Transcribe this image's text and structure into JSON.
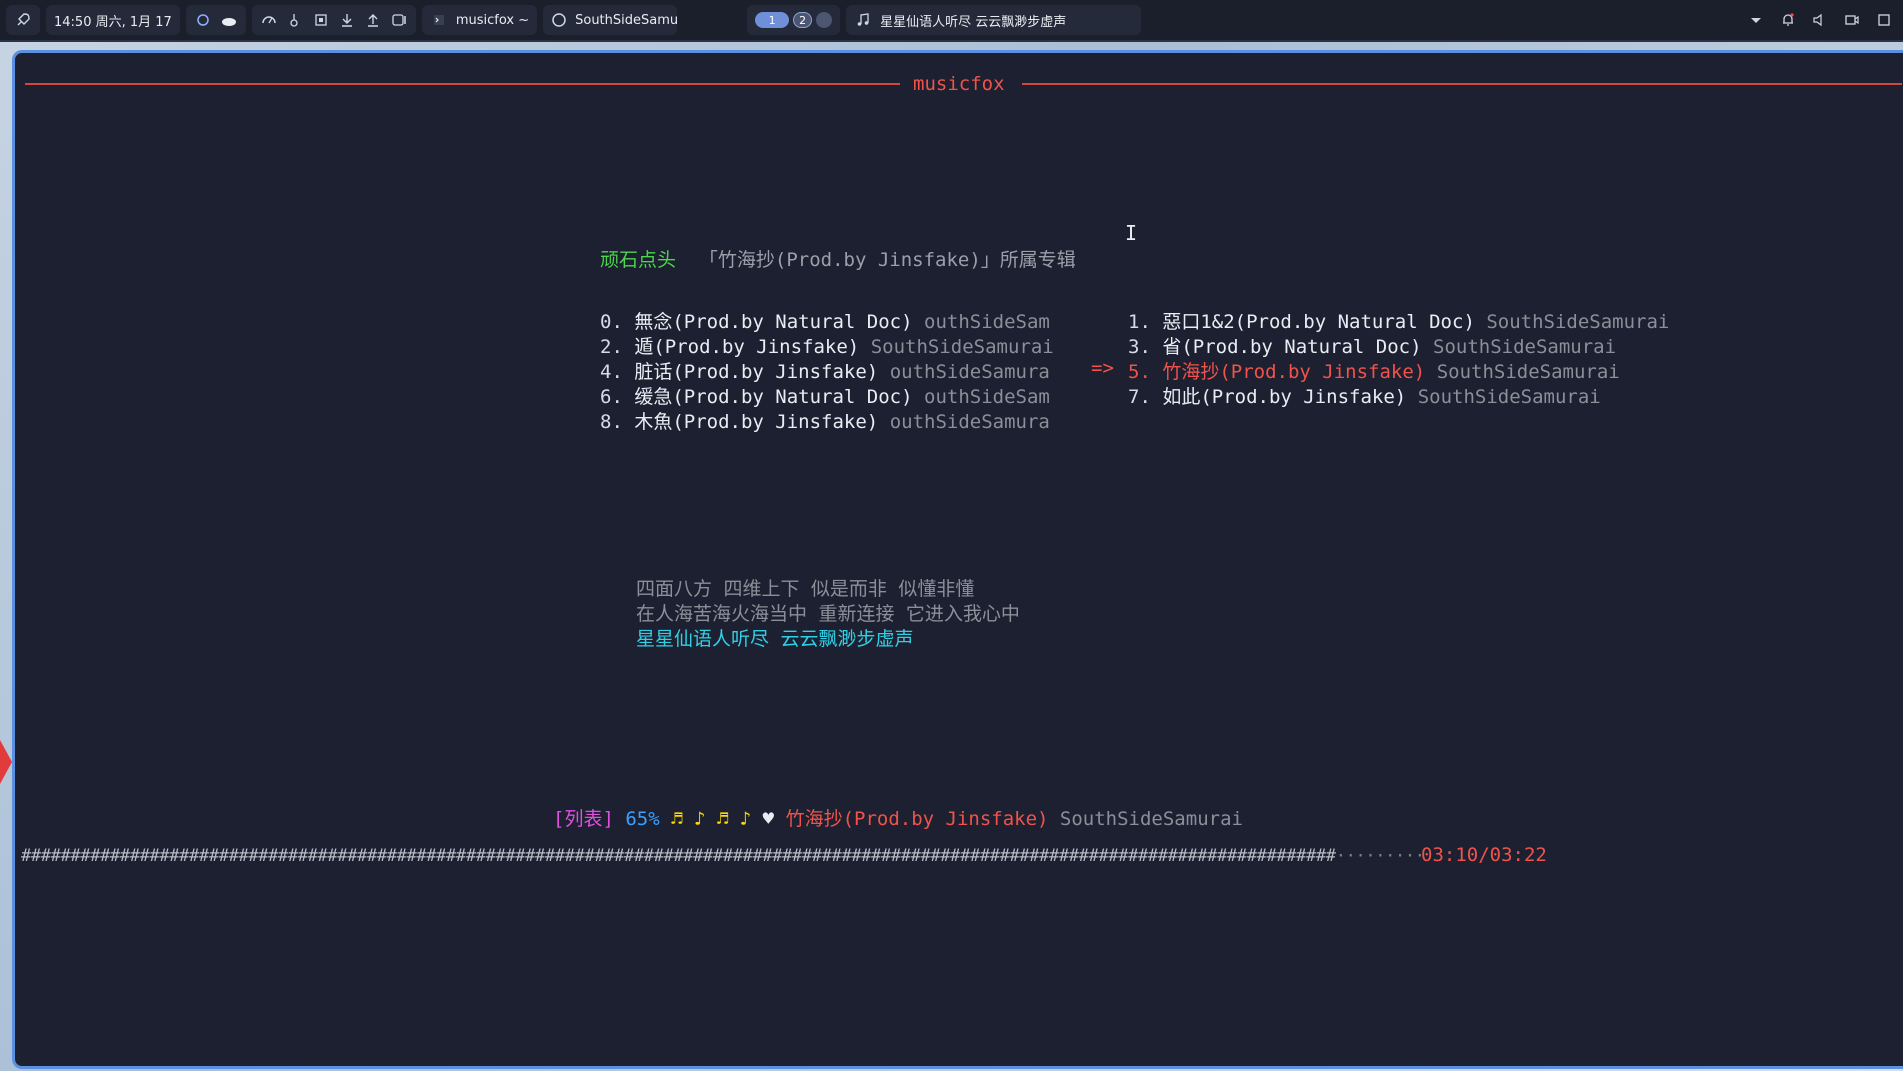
{
  "topbar": {
    "datetime": "14:50 周六, 1月 17",
    "app_name": "musicfox ~",
    "window_title": "SouthSideSamurai",
    "workspaces": [
      "1",
      "2",
      ""
    ],
    "now_playing": "星星仙语人听尽 云云飘渺步虚声"
  },
  "terminal": {
    "title": "musicfox",
    "header_artist": "顽石点头",
    "header_album": "「竹海抄(Prod.by Jinsfake)」所属专辑",
    "left_column": [
      {
        "num": "0.",
        "song": "無念(Prod.by Natural Doc)",
        "artist": "outhSideSam"
      },
      {
        "num": "2.",
        "song": "遁(Prod.by Jinsfake)",
        "artist": "SouthSideSamurai"
      },
      {
        "num": "4.",
        "song": "脏话(Prod.by Jinsfake)",
        "artist": "outhSideSamura"
      },
      {
        "num": "6.",
        "song": "缓急(Prod.by Natural Doc)",
        "artist": "outhSideSam"
      },
      {
        "num": "8.",
        "song": "木魚(Prod.by Jinsfake)",
        "artist": "outhSideSamura"
      }
    ],
    "right_column": [
      {
        "num": "1.",
        "song": "惡口1&2(Prod.by Natural Doc)",
        "artist": "SouthSideSamurai"
      },
      {
        "num": "3.",
        "song": "省(Prod.by Natural Doc)",
        "artist": "SouthSideSamurai"
      },
      {
        "num": "5.",
        "song": "竹海抄(Prod.by Jinsfake)",
        "artist": "SouthSideSamurai"
      },
      {
        "num": "7.",
        "song": "如此(Prod.by Jinsfake)",
        "artist": "SouthSideSamurai"
      }
    ],
    "selected_arrow": "=>",
    "lyrics": [
      "四面八方 四维上下 似是而非 似懂非懂",
      "在人海苦海火海当中 重新连接 它进入我心中",
      "星星仙语人听尽 云云飘渺步虚声"
    ],
    "status": {
      "mode_tag": "[列表]",
      "volume": "65%",
      "notes": "♬ ♪ ♬ ♪",
      "heart": "♥",
      "current_song": "竹海抄(Prod.by Jinsfake)",
      "current_artist": "SouthSideSamurai"
    },
    "progress": {
      "value": 0.9485,
      "played_chars": "#####################################################################################################################################",
      "remaining_chars": "·········",
      "time": "03:10/03:22"
    }
  },
  "colors": {
    "accent_red": "#f0534b",
    "artist_green": "#4bd64b",
    "lyric_cyan": "#2fd0e6",
    "tag_magenta": "#e14ee0",
    "volume_blue": "#3aa0ff",
    "notes_yellow": "#ffd800"
  }
}
